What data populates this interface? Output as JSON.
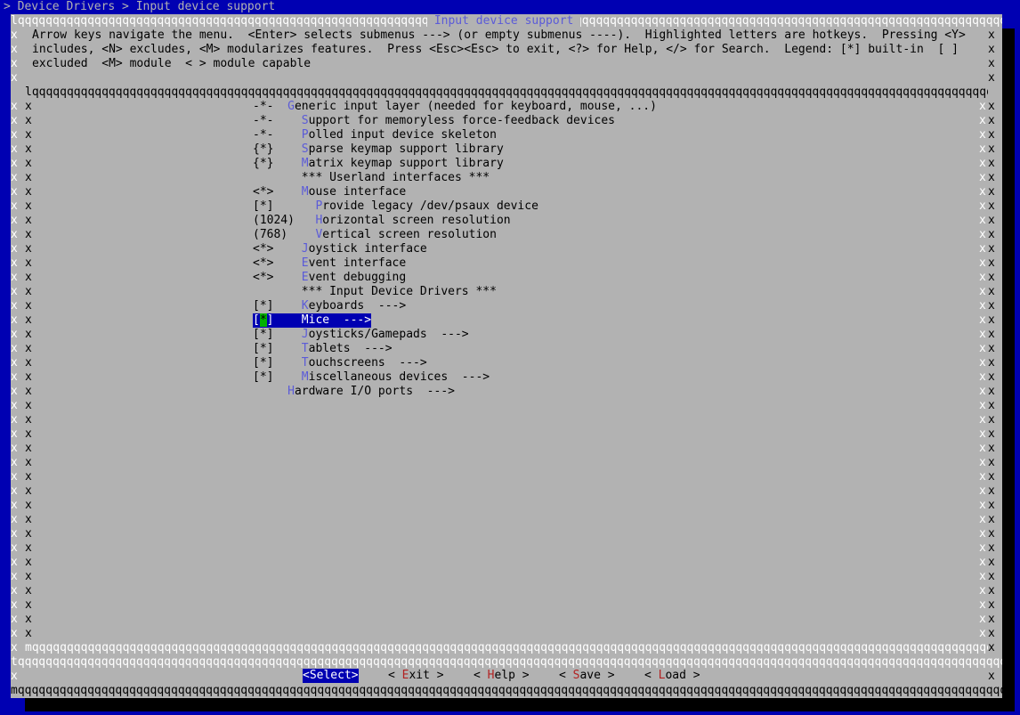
{
  "header": {
    "breadcrumb": "> Device Drivers > Input device support"
  },
  "dialog": {
    "title": " Input device support ",
    "help_lines": [
      "Arrow keys navigate the menu.  <Enter> selects submenus ---> (or empty submenus ----).  Highlighted letters are hotkeys.  Pressing <Y>",
      "includes, <N> excludes, <M> modularizes features.  Press <Esc><Esc> to exit, <?> for Help, </> for Search.  Legend: [*] built-in  [ ]",
      "excluded  <M> module  < > module capable"
    ]
  },
  "menu": {
    "items": [
      {
        "prefix": "-*-  ",
        "hotkey": "G",
        "rest": "eneric input layer (needed for keyboard, mouse, ...)"
      },
      {
        "prefix": "-*-    ",
        "hotkey": "S",
        "rest": "upport for memoryless force-feedback devices"
      },
      {
        "prefix": "-*-    ",
        "hotkey": "P",
        "rest": "olled input device skeleton"
      },
      {
        "prefix": "{*}    ",
        "hotkey": "S",
        "rest": "parse keymap support library"
      },
      {
        "prefix": "{*}    ",
        "hotkey": "M",
        "rest": "atrix keymap support library"
      },
      {
        "prefix": "       ",
        "hotkey": "",
        "rest": "*** Userland interfaces ***"
      },
      {
        "prefix": "<*>    ",
        "hotkey": "M",
        "rest": "ouse interface"
      },
      {
        "prefix": "[*]      ",
        "hotkey": "P",
        "rest": "rovide legacy /dev/psaux device"
      },
      {
        "prefix": "(1024)   ",
        "hotkey": "H",
        "rest": "orizontal screen resolution"
      },
      {
        "prefix": "(768)    ",
        "hotkey": "V",
        "rest": "ertical screen resolution"
      },
      {
        "prefix": "<*>    ",
        "hotkey": "J",
        "rest": "oystick interface"
      },
      {
        "prefix": "<*>    ",
        "hotkey": "E",
        "rest": "vent interface"
      },
      {
        "prefix": "<*>    ",
        "hotkey": "E",
        "rest": "vent debugging"
      },
      {
        "prefix": "       ",
        "hotkey": "",
        "rest": "*** Input Device Drivers ***"
      },
      {
        "prefix": "[*]    ",
        "hotkey": "K",
        "rest": "eyboards  --->"
      },
      {
        "prefix": "[",
        "cursor": "*",
        "prefix2": "]    ",
        "hotkey": "",
        "rest": "Mice  --->",
        "selected": true
      },
      {
        "prefix": "[*]    ",
        "hotkey": "J",
        "rest": "oysticks/Gamepads  --->"
      },
      {
        "prefix": "[*]    ",
        "hotkey": "T",
        "rest": "ablets  --->"
      },
      {
        "prefix": "[*]    ",
        "hotkey": "T",
        "rest": "ouchscreens  --->"
      },
      {
        "prefix": "[*]    ",
        "hotkey": "M",
        "rest": "iscellaneous devices  --->"
      },
      {
        "prefix": "     ",
        "hotkey": "H",
        "rest": "ardware I/O ports  --->"
      }
    ]
  },
  "buttons": [
    {
      "label": "<Select>",
      "selected": true
    },
    {
      "pre": "< ",
      "hotkey": "E",
      "rest": "xit >"
    },
    {
      "pre": "< ",
      "hotkey": "H",
      "rest": "elp >"
    },
    {
      "pre": "< ",
      "hotkey": "S",
      "rest": "ave >"
    },
    {
      "pre": "< ",
      "hotkey": "L",
      "rest": "oad >"
    }
  ]
}
